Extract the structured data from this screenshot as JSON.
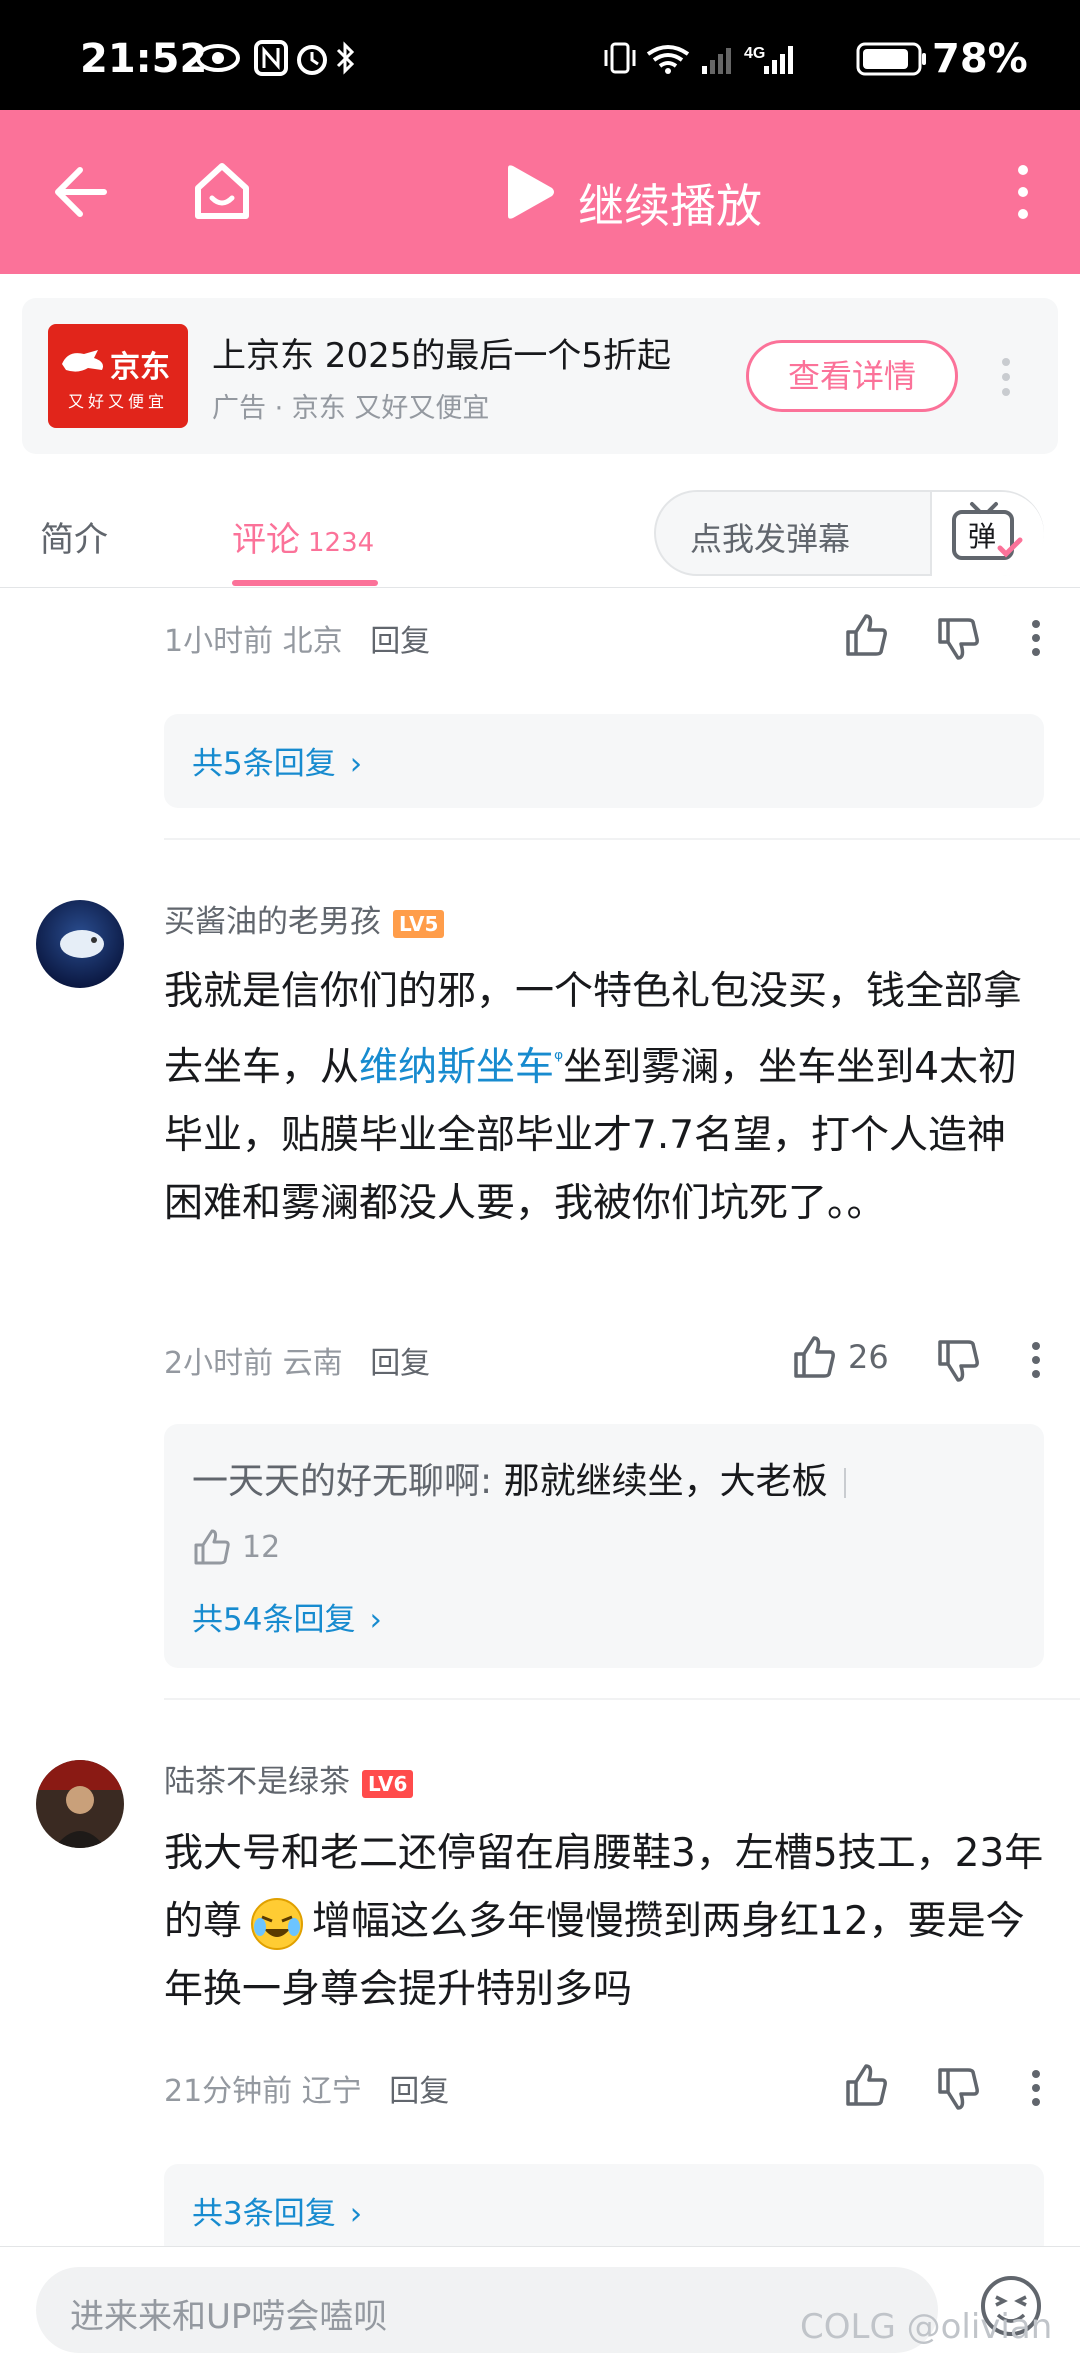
{
  "status_bar": {
    "time": "21:52",
    "network": "4G",
    "battery": "78%"
  },
  "header": {
    "play_label": "继续播放"
  },
  "ad": {
    "logo_text": "京东",
    "logo_slogan": "又好又便宜",
    "title": "上京东 2025的最后一个5折起",
    "subtitle": "广告 · 京东 又好又便宜",
    "button": "查看详情"
  },
  "tabs": {
    "intro": "简介",
    "comment": "评论",
    "comment_count": "1234",
    "danmu_placeholder": "点我发弹幕",
    "danmu_button": "弹"
  },
  "comments": [
    {
      "time": "1小时前",
      "location": "北京",
      "reply": "回复",
      "replies_more": "共5条回复"
    },
    {
      "username": "买酱油的老男孩",
      "level": "LV5",
      "content_pre": "我就是信你们的邪，一个特色礼包没买，钱全部拿去坐车，从",
      "keyword": "维纳斯坐车",
      "content_post": "坐到雾澜，坐车坐到4太初毕业，贴膜毕业全部毕业才7.7名望，打个人造神困难和雾澜都没人要，我被你们坑死了。。",
      "time": "2小时前",
      "location": "云南",
      "reply": "回复",
      "likes": "26",
      "sub_reply_user": "一天天的好无聊啊",
      "sub_reply_text": "那就继续坐，大老板",
      "sub_reply_likes": "12",
      "replies_more": "共54条回复"
    },
    {
      "username": "陆茶不是绿茶",
      "level": "LV6",
      "content_pre": "我大号和老二还停留在肩腰鞋3，左槽5技工，23年的尊",
      "content_post": "增幅这么多年慢慢攒到两身红12，要是今年换一身尊会提升特别多吗",
      "time": "21分钟前",
      "location": "辽宁",
      "reply": "回复",
      "replies_more": "共3条回复"
    }
  ],
  "bottom_bar": {
    "input_placeholder": "进来来和UP唠会嗑呗",
    "watermark": "COLG @olivian"
  }
}
